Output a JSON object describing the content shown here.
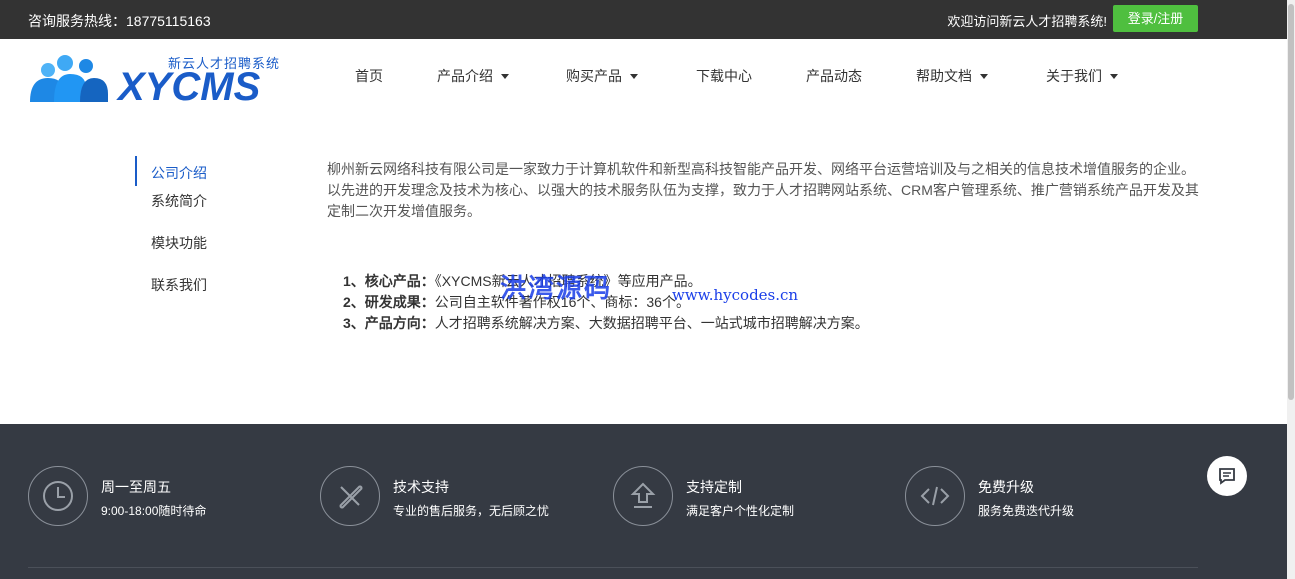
{
  "topbar": {
    "hotline": "咨询服务热线：18775115163",
    "welcome": "欢迎访问新云人才招聘系统!",
    "login_label": "登录/注册"
  },
  "logo": {
    "subtitle": "新云人才招聘系统",
    "brand": "XYCMS"
  },
  "nav": [
    {
      "label": "首页",
      "dropdown": false
    },
    {
      "label": "产品介绍",
      "dropdown": true
    },
    {
      "label": "购买产品",
      "dropdown": true
    },
    {
      "label": "下载中心",
      "dropdown": false
    },
    {
      "label": "产品动态",
      "dropdown": false
    },
    {
      "label": "帮助文档",
      "dropdown": true
    },
    {
      "label": "关于我们",
      "dropdown": true
    }
  ],
  "sidebar": {
    "items": [
      {
        "label": "公司介绍",
        "active": true
      },
      {
        "label": "系统简介",
        "active": false
      },
      {
        "label": "模块功能",
        "active": false
      },
      {
        "label": "联系我们",
        "active": false
      }
    ]
  },
  "content": {
    "intro": "柳州新云网络科技有限公司是一家致力于计算机软件和新型高科技智能产品开发、网络平台运营培训及与之相关的信息技术增值服务的企业。以先进的开发理念及技术为核心、以强大的技术服务队伍为支撑，致力于人才招聘网站系统、CRM客户管理系统、推广营销系统产品开发及其定制二次开发增值服务。",
    "points": [
      {
        "title": "1、核心产品：",
        "text": "《XYCMS新云人才招聘系统》等应用产品。"
      },
      {
        "title": "2、研发成果：",
        "text": "公司自主软件著作权16个、商标：36个。"
      },
      {
        "title": "3、产品方向：",
        "text": "人才招聘系统解决方案、大数据招聘平台、一站式城市招聘解决方案。"
      }
    ],
    "watermark": "洪湾源码",
    "watermark_url": "www.hycodes.cn"
  },
  "footer": {
    "features": [
      {
        "icon": "clock-icon",
        "title": "周一至周五",
        "desc": "9:00-18:00随时待命"
      },
      {
        "icon": "tools-icon",
        "title": "技术支持",
        "desc": "专业的售后服务，无后顾之忧"
      },
      {
        "icon": "upload-icon",
        "title": "支持定制",
        "desc": "满足客户个性化定制"
      },
      {
        "icon": "code-icon",
        "title": "免费升级",
        "desc": "服务免费迭代升级"
      }
    ]
  },
  "colors": {
    "accent": "#1a5cc8",
    "login": "#4fbf3f",
    "topbar": "#333333",
    "footer": "#353a43"
  }
}
